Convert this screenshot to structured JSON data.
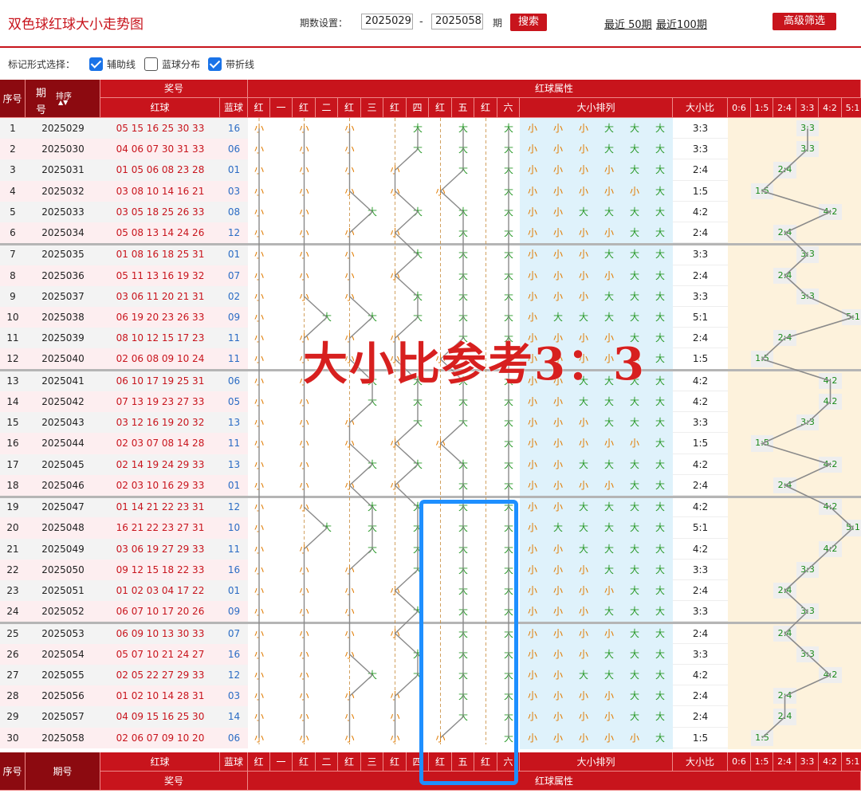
{
  "header": {
    "title": "双色球红球大小走势图",
    "period_label": "期数设置：",
    "from": "2025029",
    "dash": "-",
    "to": "2025058",
    "unit": "期",
    "search_label": "搜索",
    "recent50": "最近 50期",
    "recent100": "最近100期",
    "advanced_label": "高级筛选"
  },
  "options": {
    "label": "标记形式选择：",
    "aux": "辅助线",
    "blue": "蓝球分布",
    "line": "带折线"
  },
  "headers": {
    "seq": "序号",
    "issue_a": "期",
    "issue_b": "号",
    "sort": "排序",
    "prize": "奖号",
    "red": "红球",
    "blue": "蓝球",
    "attr": "红球属性",
    "pos": [
      "红",
      "一",
      "红",
      "二",
      "红",
      "三",
      "红",
      "四",
      "红",
      "五",
      "红",
      "六"
    ],
    "seqsize": "大小排列",
    "ratio": "大小比",
    "ratios": [
      "0:6",
      "1:5",
      "2:4",
      "3:3",
      "4:2",
      "5:1"
    ],
    "issue_full": "期号"
  },
  "rows": [
    {
      "seq": "1",
      "issue": "2025029",
      "red": "05 15 16 25 30 33",
      "blue": "16",
      "pat": "小小小大大大",
      "ratio": "3:3"
    },
    {
      "seq": "2",
      "issue": "2025030",
      "red": "04 06 07 30 31 33",
      "blue": "06",
      "pat": "小小小大大大",
      "ratio": "3:3"
    },
    {
      "seq": "3",
      "issue": "2025031",
      "red": "01 05 06 08 23 28",
      "blue": "01",
      "pat": "小小小小大大",
      "ratio": "2:4"
    },
    {
      "seq": "4",
      "issue": "2025032",
      "red": "03 08 10 14 16 21",
      "blue": "03",
      "pat": "小小小小小大",
      "ratio": "1:5"
    },
    {
      "seq": "5",
      "issue": "2025033",
      "red": "03 05 18 25 26 33",
      "blue": "08",
      "pat": "小小大大大大",
      "ratio": "4:2"
    },
    {
      "seq": "6",
      "issue": "2025034",
      "red": "05 08 13 14 24 26",
      "blue": "12",
      "pat": "小小小小大大",
      "ratio": "2:4"
    },
    {
      "seq": "7",
      "issue": "2025035",
      "red": "01 08 16 18 25 31",
      "blue": "01",
      "pat": "小小小大大大",
      "ratio": "3:3"
    },
    {
      "seq": "8",
      "issue": "2025036",
      "red": "05 11 13 16 19 32",
      "blue": "07",
      "pat": "小小小小大大",
      "ratio": "2:4"
    },
    {
      "seq": "9",
      "issue": "2025037",
      "red": "03 06 11 20 21 31",
      "blue": "02",
      "pat": "小小小大大大",
      "ratio": "3:3"
    },
    {
      "seq": "10",
      "issue": "2025038",
      "red": "06 19 20 23 26 33",
      "blue": "09",
      "pat": "小大大大大大",
      "ratio": "5:1"
    },
    {
      "seq": "11",
      "issue": "2025039",
      "red": "08 10 12 15 17 23",
      "blue": "11",
      "pat": "小小小小大大",
      "ratio": "2:4"
    },
    {
      "seq": "12",
      "issue": "2025040",
      "red": "02 06 08 09 10 24",
      "blue": "11",
      "pat": "小小小小小大",
      "ratio": "1:5"
    },
    {
      "seq": "13",
      "issue": "2025041",
      "red": "06 10 17 19 25 31",
      "blue": "06",
      "pat": "小小大大大大",
      "ratio": "4:2"
    },
    {
      "seq": "14",
      "issue": "2025042",
      "red": "07 13 19 23 27 33",
      "blue": "05",
      "pat": "小小大大大大",
      "ratio": "4:2"
    },
    {
      "seq": "15",
      "issue": "2025043",
      "red": "03 12 16 19 20 32",
      "blue": "13",
      "pat": "小小小大大大",
      "ratio": "3:3"
    },
    {
      "seq": "16",
      "issue": "2025044",
      "red": "02 03 07 08 14 28",
      "blue": "11",
      "pat": "小小小小小大",
      "ratio": "1:5"
    },
    {
      "seq": "17",
      "issue": "2025045",
      "red": "02 14 19 24 29 33",
      "blue": "13",
      "pat": "小小大大大大",
      "ratio": "4:2"
    },
    {
      "seq": "18",
      "issue": "2025046",
      "red": "02 03 10 16 29 33",
      "blue": "01",
      "pat": "小小小小大大",
      "ratio": "2:4"
    },
    {
      "seq": "19",
      "issue": "2025047",
      "red": "01 14 21 22 23 31",
      "blue": "12",
      "pat": "小小大大大大",
      "ratio": "4:2"
    },
    {
      "seq": "20",
      "issue": "2025048",
      "red": "16 21 22 23 27 31",
      "blue": "10",
      "pat": "小大大大大大",
      "ratio": "5:1"
    },
    {
      "seq": "21",
      "issue": "2025049",
      "red": "03 06 19 27 29 33",
      "blue": "11",
      "pat": "小小大大大大",
      "ratio": "4:2"
    },
    {
      "seq": "22",
      "issue": "2025050",
      "red": "09 12 15 18 22 33",
      "blue": "16",
      "pat": "小小小大大大",
      "ratio": "3:3"
    },
    {
      "seq": "23",
      "issue": "2025051",
      "red": "01 02 03 04 17 22",
      "blue": "01",
      "pat": "小小小小大大",
      "ratio": "2:4"
    },
    {
      "seq": "24",
      "issue": "2025052",
      "red": "06 07 10 17 20 26",
      "blue": "09",
      "pat": "小小小大大大",
      "ratio": "3:3"
    },
    {
      "seq": "25",
      "issue": "2025053",
      "red": "06 09 10 13 30 33",
      "blue": "07",
      "pat": "小小小小大大",
      "ratio": "2:4"
    },
    {
      "seq": "26",
      "issue": "2025054",
      "red": "05 07 10 21 24 27",
      "blue": "16",
      "pat": "小小小大大大",
      "ratio": "3:3"
    },
    {
      "seq": "27",
      "issue": "2025055",
      "red": "02 05 22 27 29 33",
      "blue": "12",
      "pat": "小小大大大大",
      "ratio": "4:2"
    },
    {
      "seq": "28",
      "issue": "2025056",
      "red": "01 02 10 14 28 31",
      "blue": "03",
      "pat": "小小小小大大",
      "ratio": "2:4"
    },
    {
      "seq": "29",
      "issue": "2025057",
      "red": "04 09 15 16 25 30",
      "blue": "14",
      "pat": "小小小小大大",
      "ratio": "2:4"
    },
    {
      "seq": "30",
      "issue": "2025058",
      "red": "02 06 07 09 10 20",
      "blue": "06",
      "pat": "小小小小小大",
      "ratio": "1:5"
    }
  ],
  "overlay_text": "大小比参考3：3",
  "colors": {
    "red": "#c8141c",
    "dark_red": "#8c0a10",
    "small": "#e07b00",
    "big": "#2a9a2a",
    "blue_box": "#1e8fff",
    "pink": "#fdeef0",
    "lightblue": "#dff2fb",
    "cream": "#fdf2dc"
  }
}
